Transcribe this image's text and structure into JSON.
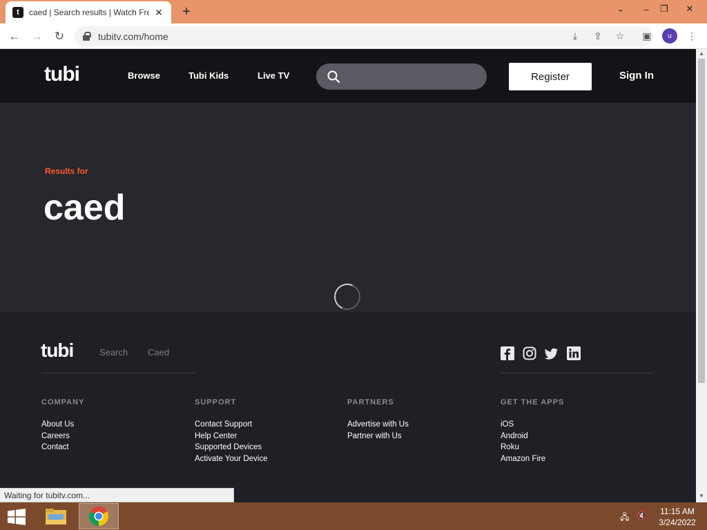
{
  "browser": {
    "tab_title": "caed | Search results | Watch Free",
    "favicon_letter": "t",
    "url": "tubitv.com/home",
    "avatar_letter": "u",
    "status_text": "Waiting for tubitv.com..."
  },
  "header": {
    "logo": "tubi",
    "nav": [
      "Browse",
      "Tubi Kids",
      "Live TV"
    ],
    "search_placeholder": "",
    "register_label": "Register",
    "signin_label": "Sign In"
  },
  "main": {
    "results_label": "Results for",
    "query": "caed"
  },
  "footer": {
    "logo": "tubi",
    "breadcrumb": [
      "Search",
      "Caed"
    ],
    "social_icons": [
      "facebook-icon",
      "instagram-icon",
      "twitter-icon",
      "linkedin-icon"
    ],
    "columns": [
      {
        "title": "COMPANY",
        "links": [
          "About Us",
          "Careers",
          "Contact"
        ]
      },
      {
        "title": "SUPPORT",
        "links": [
          "Contact Support",
          "Help Center",
          "Supported Devices",
          "Activate Your Device"
        ]
      },
      {
        "title": "PARTNERS",
        "links": [
          "Advertise with Us",
          "Partner with Us"
        ]
      },
      {
        "title": "GET THE APPS",
        "links": [
          "iOS",
          "Android",
          "Roku",
          "Amazon Fire"
        ]
      }
    ]
  },
  "taskbar": {
    "time": "11:15 AM",
    "date": "3/24/2022"
  },
  "colors": {
    "accent": "#ff5a2b",
    "header_bg": "#141418",
    "page_bg": "#27272e",
    "footer_bg": "#1f1f25",
    "tabstrip_bg": "#e8956b",
    "taskbar_bg": "#7b4a2c"
  }
}
